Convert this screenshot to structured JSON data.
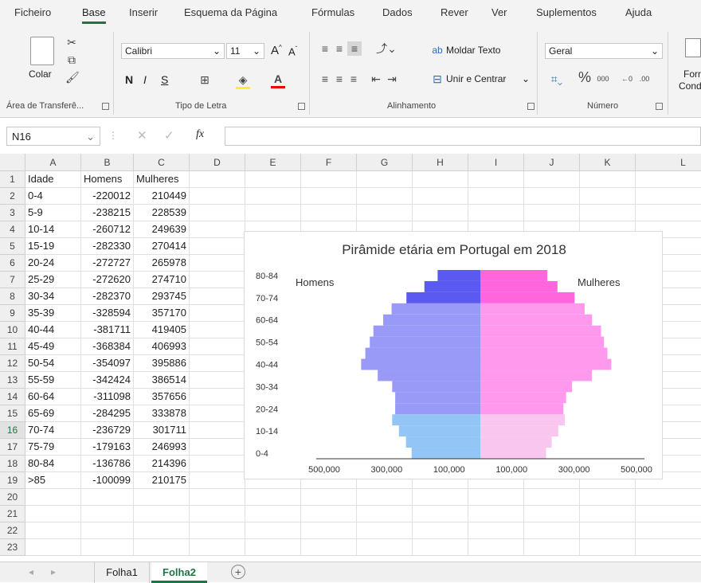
{
  "ribbon": {
    "tabs": [
      "Ficheiro",
      "Base",
      "Inserir",
      "Esquema da Página",
      "Fórmulas",
      "Dados",
      "Rever",
      "Ver",
      "Suplementos",
      "Ajuda"
    ],
    "active_tab": "Base",
    "groups": {
      "clipboard": {
        "label": "Área de Transferê...",
        "paste": "Colar"
      },
      "font": {
        "label": "Tipo de Letra",
        "font_name": "Calibri",
        "font_size": "11",
        "bold": "N",
        "italic": "I",
        "underline": "S"
      },
      "alignment": {
        "label": "Alinhamento",
        "wrap": "Moldar Texto",
        "merge": "Unir e Centrar"
      },
      "number": {
        "label": "Número",
        "format": "Geral"
      },
      "extra": {
        "line1": "Forr",
        "line2": "Cond"
      }
    }
  },
  "formula_bar": {
    "name_box": "N16",
    "fx": "fx",
    "content": ""
  },
  "columns": [
    "A",
    "B",
    "C",
    "D",
    "E",
    "F",
    "G",
    "H",
    "I",
    "J",
    "K",
    "L"
  ],
  "rows": [
    {
      "n": "1",
      "a": "Idade",
      "b": "Homens",
      "c": "Mulheres"
    },
    {
      "n": "2",
      "a": "0-4",
      "b": "-220012",
      "c": "210449"
    },
    {
      "n": "3",
      "a": "5-9",
      "b": "-238215",
      "c": "228539"
    },
    {
      "n": "4",
      "a": "10-14",
      "b": "-260712",
      "c": "249639"
    },
    {
      "n": "5",
      "a": "15-19",
      "b": "-282330",
      "c": "270414"
    },
    {
      "n": "6",
      "a": "20-24",
      "b": "-272727",
      "c": "265978"
    },
    {
      "n": "7",
      "a": "25-29",
      "b": "-272620",
      "c": "274710"
    },
    {
      "n": "8",
      "a": "30-34",
      "b": "-282370",
      "c": "293745"
    },
    {
      "n": "9",
      "a": "35-39",
      "b": "-328594",
      "c": "357170"
    },
    {
      "n": "10",
      "a": "40-44",
      "b": "-381711",
      "c": "419405"
    },
    {
      "n": "11",
      "a": "45-49",
      "b": "-368384",
      "c": "406993"
    },
    {
      "n": "12",
      "a": "50-54",
      "b": "-354097",
      "c": "395886"
    },
    {
      "n": "13",
      "a": "55-59",
      "b": "-342424",
      "c": "386514"
    },
    {
      "n": "14",
      "a": "60-64",
      "b": "-311098",
      "c": "357656"
    },
    {
      "n": "15",
      "a": "65-69",
      "b": "-284295",
      "c": "333878"
    },
    {
      "n": "16",
      "a": "70-74",
      "b": "-236729",
      "c": "301711"
    },
    {
      "n": "17",
      "a": "75-79",
      "b": "-179163",
      "c": "246993"
    },
    {
      "n": "18",
      "a": "80-84",
      "b": "-136786",
      "c": "214396"
    },
    {
      "n": "19",
      "a": ">85",
      "b": "-100099",
      "c": "210175"
    },
    {
      "n": "20",
      "a": "",
      "b": "",
      "c": ""
    },
    {
      "n": "21",
      "a": "",
      "b": "",
      "c": ""
    },
    {
      "n": "22",
      "a": "",
      "b": "",
      "c": ""
    },
    {
      "n": "23",
      "a": "",
      "b": "",
      "c": ""
    }
  ],
  "sheets": {
    "tabs": [
      "Folha1",
      "Folha2"
    ],
    "active": "Folha2"
  },
  "colors": {
    "accent": "#217346",
    "men_young": "#93c5f7",
    "men_adult": "#9999f8",
    "men_old": "#5a5af0",
    "women_young": "#f9c6ef",
    "women_adult": "#ff99ee",
    "women_old": "#ff66dd"
  },
  "chart_data": {
    "type": "bar",
    "orientation": "horizontal",
    "title": "Pirâmide etária em Portugal em 2018",
    "categories": [
      "0-4",
      "5-9",
      "10-14",
      "15-19",
      "20-24",
      "25-29",
      "30-34",
      "35-39",
      "40-44",
      "45-49",
      "50-54",
      "55-59",
      "60-64",
      "65-69",
      "70-74",
      "75-79",
      "80-84"
    ],
    "y_tick_labels": [
      "0-4",
      "10-14",
      "20-24",
      "30-34",
      "40-44",
      "50-54",
      "60-64",
      "70-74",
      "80-84"
    ],
    "series": [
      {
        "name": "Homens",
        "values": [
          -220012,
          -238215,
          -260712,
          -282330,
          -272727,
          -272620,
          -282370,
          -328594,
          -381711,
          -368384,
          -354097,
          -342424,
          -311098,
          -284295,
          -236729,
          -179163,
          -136786
        ]
      },
      {
        "name": "Mulheres",
        "values": [
          210449,
          228539,
          249639,
          270414,
          265978,
          274710,
          293745,
          357170,
          419405,
          406993,
          395886,
          386514,
          357656,
          333878,
          301711,
          246993,
          214396
        ]
      }
    ],
    "x_tick_labels": [
      "500,000",
      "300,000",
      "100,000",
      "100,000",
      "300,000",
      "500,000"
    ],
    "xlim": [
      -500000,
      500000
    ],
    "legend": "top"
  }
}
